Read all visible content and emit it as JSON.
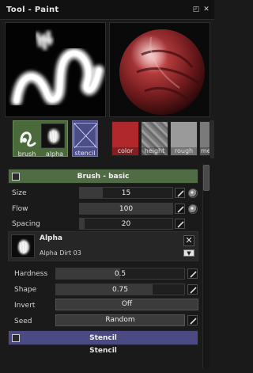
{
  "window": {
    "title": "Tool - Paint",
    "pin_icon": "pin-icon",
    "close_icon": "close-icon"
  },
  "previews": {
    "stroke": "stroke-preview",
    "sphere": "sphere-preview"
  },
  "brush_tiles": [
    {
      "label": "brush",
      "icon": "brush-shape-icon"
    },
    {
      "label": "alpha",
      "icon": "alpha-shape-icon"
    },
    {
      "label": "stencil",
      "icon": "stencil-empty-icon"
    }
  ],
  "channels": [
    {
      "label": "color",
      "color": "#b0282c"
    },
    {
      "label": "height",
      "color": "#8a8a8a"
    },
    {
      "label": "rough",
      "color": "#9a9a9a"
    },
    {
      "label": "met",
      "color": "#7a7a7a"
    }
  ],
  "brush_section": {
    "title": "Brush - basic",
    "params": [
      {
        "label": "Size",
        "value": "15",
        "fill": 0.25
      },
      {
        "label": "Flow",
        "value": "100",
        "fill": 1.0
      },
      {
        "label": "Spacing",
        "value": "20",
        "fill": 0.05
      }
    ]
  },
  "alpha_section": {
    "title": "Alpha",
    "name": "Alpha Dirt 03",
    "params": [
      {
        "label": "Hardness",
        "value": "0.5",
        "fill": 0.5
      },
      {
        "label": "Shape",
        "value": "0.75",
        "fill": 0.75
      },
      {
        "label": "Invert",
        "value": "Off"
      },
      {
        "label": "Seed",
        "value": "Random"
      }
    ]
  },
  "stencil_section": {
    "title": "Stencil",
    "subtitle": "Stencil"
  },
  "colors": {
    "brush_header": "#4f6c44",
    "stencil_header": "#4b4a82",
    "accent_red": "#b0282c"
  }
}
